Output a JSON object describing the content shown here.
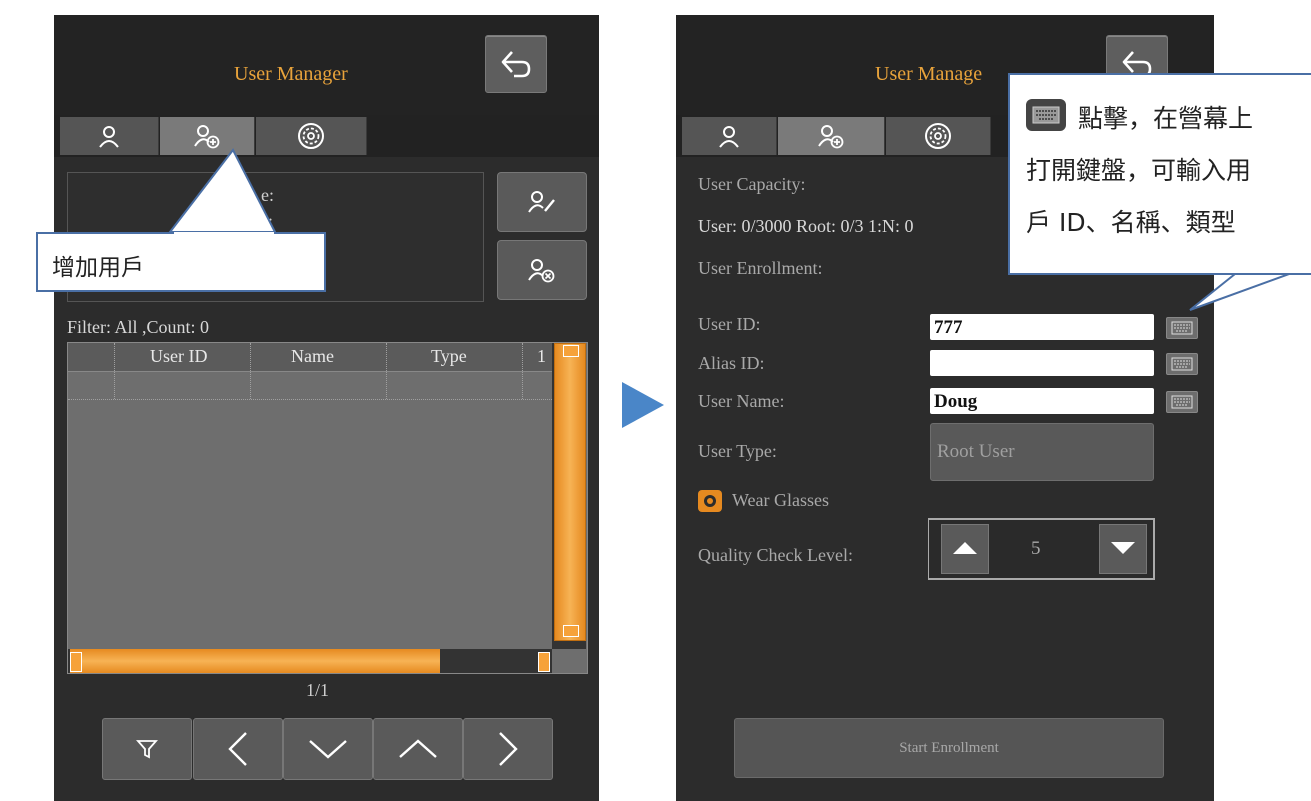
{
  "left_screen": {
    "title": "User Manager",
    "info_fragment_1": "e:",
    "info_fragment_2": ":",
    "filter_text": "Filter: All ,Count: 0",
    "table": {
      "columns": [
        "User ID",
        "Name",
        "Type",
        "1"
      ]
    },
    "page_indicator": "1/1",
    "nav_buttons": [
      "filter-icon",
      "chevron-left-icon",
      "chevron-down-icon",
      "chevron-up-icon",
      "chevron-right-icon"
    ]
  },
  "left_callout": {
    "text": "增加用戶"
  },
  "right_screen": {
    "title": "User Manage",
    "capacity_label": "User Capacity:",
    "capacity_value": "User: 0/3000  Root: 0/3  1:N: 0",
    "enrollment_label": "User Enrollment:",
    "fields": {
      "user_id_label": "User ID:",
      "user_id_value": "777",
      "alias_id_label": "Alias ID:",
      "alias_id_value": "",
      "user_name_label": "User Name:",
      "user_name_value": "Doug",
      "user_type_label": "User Type:",
      "user_type_value": "Root User"
    },
    "wear_glasses_label": "Wear Glasses",
    "quality_label": "Quality Check Level:",
    "quality_value": "5",
    "start_button": "Start Enrollment"
  },
  "right_callout": {
    "line1": "點擊，在營幕上",
    "line2": "打開鍵盤，可輸入用",
    "line3": "戶 ID、名稱、類型"
  },
  "colors": {
    "accent_orange": "#e8a33b",
    "callout_border": "#4a6fa5",
    "arrow_blue": "#4a86c8"
  }
}
